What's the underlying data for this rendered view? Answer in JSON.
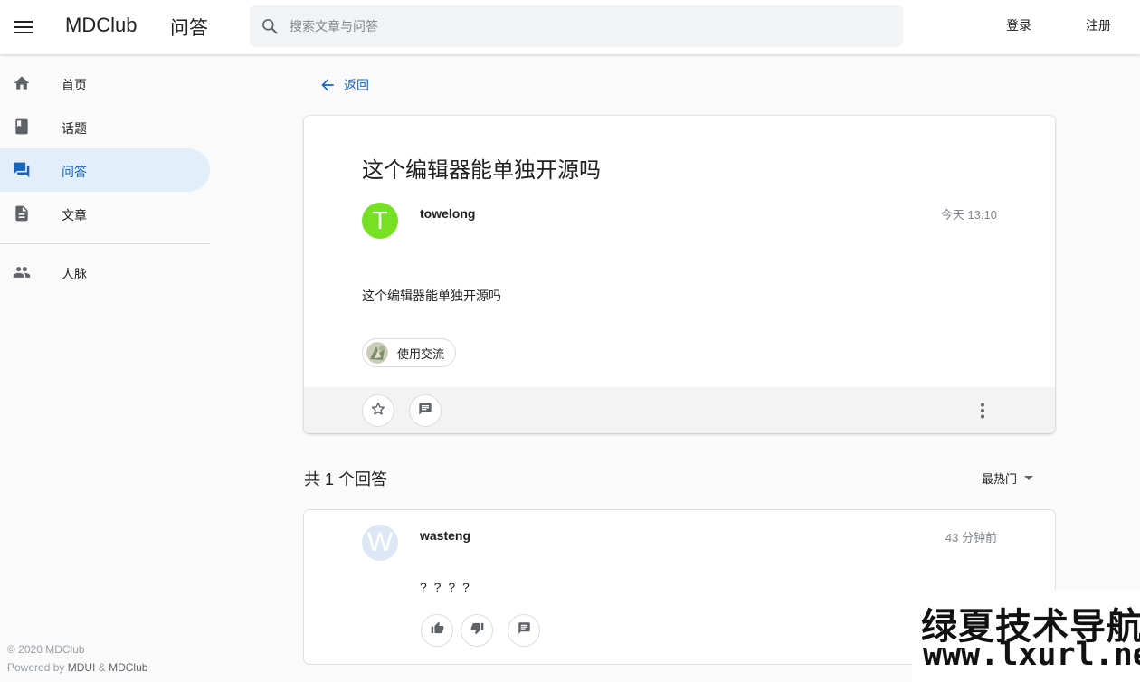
{
  "appbar": {
    "brand": "MDClub",
    "section": "问答",
    "search_placeholder": "搜索文章与问答",
    "login": "登录",
    "register": "注册"
  },
  "drawer": {
    "items": [
      {
        "label": "首页",
        "icon": "home-icon"
      },
      {
        "label": "话题",
        "icon": "book-icon"
      },
      {
        "label": "问答",
        "icon": "forum-icon",
        "active": true
      },
      {
        "label": "文章",
        "icon": "description-icon"
      },
      {
        "label": "人脉",
        "icon": "people-icon"
      }
    ],
    "footer_copyright": "© 2020 MDClub",
    "footer_powered": "Powered by",
    "footer_mdui": "MDUI",
    "footer_amp": "&",
    "footer_mdclub": "MDClub"
  },
  "main": {
    "back_label": "返回",
    "question": {
      "title": "这个编辑器能单独开源吗",
      "author": "towelong",
      "avatar_letter": "T",
      "time": "今天 13:10",
      "body": "这个编辑器能单独开源吗",
      "topic_chip": "使用交流"
    },
    "answers_count": "共 1 个回答",
    "sort_label": "最热门",
    "answer": {
      "author": "wasteng",
      "avatar_letter": "W",
      "time": "43 分钟前",
      "body": "? ? ? ?"
    }
  },
  "watermark": {
    "line1": "绿夏技术导航",
    "line2": "www.lxurl.net"
  },
  "colors": {
    "accent": "#1565c0",
    "active_nav_bg": "#e3eefb",
    "avatar_t": "#76e022",
    "avatar_w": "#dde7f5"
  }
}
